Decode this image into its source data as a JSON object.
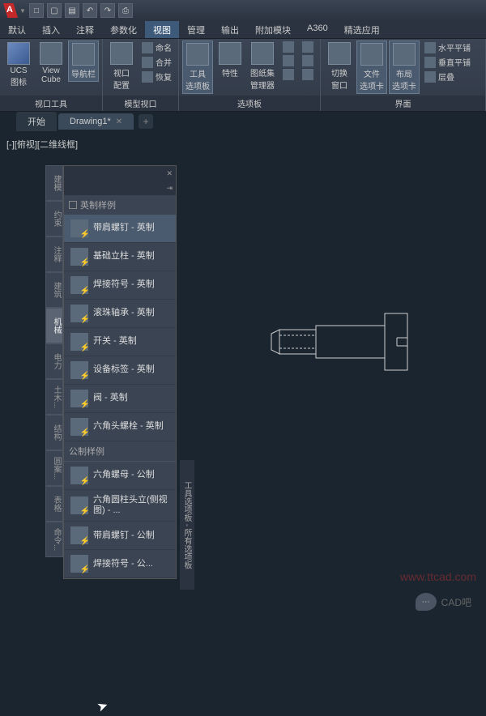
{
  "titlebar": {
    "app_letter": "A"
  },
  "menus": [
    "默认",
    "插入",
    "注释",
    "参数化",
    "视图",
    "管理",
    "输出",
    "附加模块",
    "A360",
    "精选应用"
  ],
  "active_menu": 4,
  "ribbon": {
    "ucs": "UCS\n图标",
    "viewcube": "View\nCube",
    "navbar": "导航栏",
    "vpcfg": "视口\n配置",
    "ming": "命名",
    "hebi": "合并",
    "hui": "恢复",
    "group1": "视口工具",
    "group2": "模型视口",
    "tool_pal": "工具\n选项板",
    "props": "特性",
    "sheet": "图纸集\n管理器",
    "group3": "选项板",
    "switch": "切换\n窗口",
    "file_tab": "文件\n选项卡",
    "layout_tab": "布局\n选项卡",
    "hp": "水平平铺",
    "vp": "垂直平铺",
    "casc": "层叠",
    "group4": "界面"
  },
  "tabs": {
    "start": "开始",
    "drawing": "Drawing1*"
  },
  "vp_label": "[-][俯视][二维线框]",
  "vtabs": [
    "建模",
    "约束",
    "注释",
    "建筑",
    "机械",
    "电力",
    "土木...",
    "结构",
    "圆案...",
    "表格",
    "命令..."
  ],
  "active_vtab": 4,
  "palette": {
    "sec1": "英制样例",
    "sec2": "公制样例",
    "items": [
      "带肩螺钉 - 英制",
      "基础立柱 - 英制",
      "焊接符号 - 英制",
      "滚珠轴承 - 英制",
      "开关 - 英制",
      "设备标签 - 英制",
      "阀 - 英制",
      "六角头螺栓 - 英制"
    ],
    "items2": [
      "六角螺母 - 公制",
      "六角圆柱头立(侧视图) - ...",
      "带肩螺钉 - 公制",
      "焊接符号 - 公..."
    ]
  },
  "rpanel": "工具选项板 - 所有选项板",
  "watermark": "www.ttcad.com",
  "chat": "CAD吧"
}
